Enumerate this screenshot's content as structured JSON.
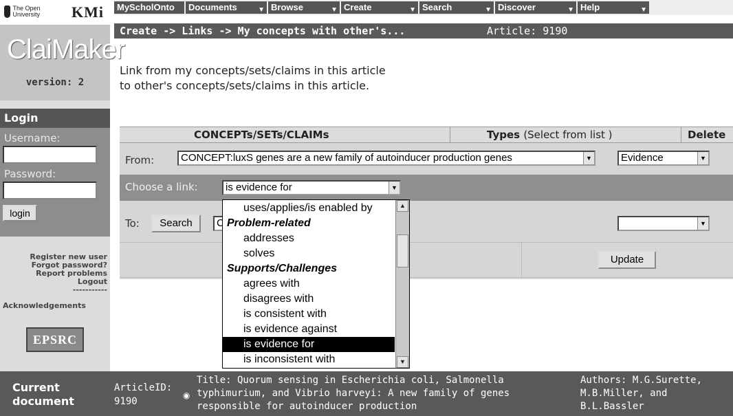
{
  "logos": {
    "ou": "The Open University",
    "kmi": "KMi"
  },
  "brand": {
    "name": "ClaiMaker",
    "version": "version: 2"
  },
  "login": {
    "title": "Login",
    "username_label": "Username:",
    "username_value": "",
    "password_label": "Password:",
    "password_value": "",
    "button": "login"
  },
  "left_links": {
    "register": "Register new user",
    "forgot": "Forgot password?",
    "report": "Report problems",
    "logout": "Logout",
    "separator": "-----------",
    "acknowledgements": "Acknowledgements",
    "sponsor": "EPSRC"
  },
  "menu": [
    {
      "label": "MyScholOnto",
      "has_arrow": false
    },
    {
      "label": "Documents",
      "has_arrow": true
    },
    {
      "label": "Browse",
      "has_arrow": true
    },
    {
      "label": "Create",
      "has_arrow": true
    },
    {
      "label": "Search",
      "has_arrow": true
    },
    {
      "label": "Discover",
      "has_arrow": true
    },
    {
      "label": "Help",
      "has_arrow": true
    }
  ],
  "breadcrumb": {
    "path": "Create -> Links -> My concepts with other's...",
    "article": "Article: 9190"
  },
  "intro": {
    "line1": "Link from my concepts/sets/claims in this article",
    "line2": "to other's concepts/sets/claims in this article."
  },
  "table": {
    "header_items": "CONCEPTs/SETs/CLAIMs",
    "header_types": "Types",
    "header_types_hint": "(Select from list )",
    "header_delete": "Delete",
    "from_label": "From:",
    "from_value": "CONCEPT:luxS genes are a new family of autoinducer production genes",
    "from_type": "Evidence",
    "choose_label": "Choose a link:",
    "choose_value": "is evidence for",
    "to_label": "To:",
    "search_button": "Search",
    "to_value": "C",
    "to_type": "",
    "update_button": "Update"
  },
  "dropdown": {
    "options": [
      {
        "label": "uses/applies/is enabled by",
        "group": false,
        "selected": false
      },
      {
        "label": "Problem-related",
        "group": true,
        "selected": false
      },
      {
        "label": "addresses",
        "group": false,
        "selected": false
      },
      {
        "label": "solves",
        "group": false,
        "selected": false
      },
      {
        "label": "Supports/Challenges",
        "group": true,
        "selected": false
      },
      {
        "label": "agrees with",
        "group": false,
        "selected": false
      },
      {
        "label": "disagrees with",
        "group": false,
        "selected": false
      },
      {
        "label": "is consistent with",
        "group": false,
        "selected": false
      },
      {
        "label": "is evidence against",
        "group": false,
        "selected": false
      },
      {
        "label": "is evidence for",
        "group": false,
        "selected": true
      },
      {
        "label": "is inconsistent with",
        "group": false,
        "selected": false
      }
    ]
  },
  "footer": {
    "label_line1": "Current",
    "label_line2": "document",
    "id_label": "ArticleID:",
    "id_value": "9190",
    "title": "Title: Quorum sensing in Escherichia coli, Salmonella typhimurium, and Vibrio harveyi: A new family of genes responsible for autoinducer production",
    "authors": "Authors: M.G.Surette, M.B.Miller, and B.L.Bassler"
  }
}
